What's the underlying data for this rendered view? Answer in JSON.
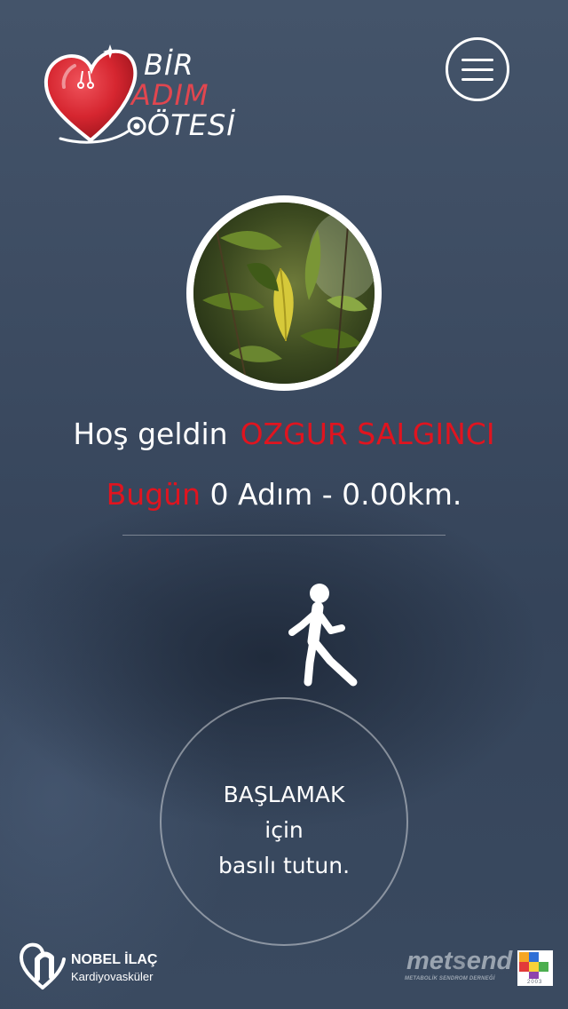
{
  "header": {
    "logo": {
      "word1": "BİR",
      "word2": "ADIM",
      "word3": "ÖTESİ",
      "icon": "heart-stethoscope-icon",
      "colors": {
        "heart": "#d62630",
        "word_accent": "#e1464f"
      }
    },
    "menu_icon": "hamburger-menu-icon"
  },
  "profile": {
    "avatar_icon": "leaf-photo",
    "welcome_prefix": "Hoş geldin",
    "user_name": "OZGUR SALGINCI"
  },
  "stats": {
    "today_label": "Bugün",
    "steps_text": " 0 Adım - 0.00km."
  },
  "walk_icon": "walking-person-icon",
  "start_button": {
    "line1": "BAŞLAMAK",
    "line2": "için",
    "line3": "basılı tutun."
  },
  "footer": {
    "nobel": {
      "name": "NOBEL İLAÇ",
      "sub": "Kardiyovasküler",
      "icon": "nobel-n-heart-icon"
    },
    "metsend": {
      "word_start": "met",
      "word_mid": "s",
      "word_end": "end",
      "tagline": "METABOLİK SENDROM DERNEĞİ",
      "year": "2003",
      "icon": "metsend-squares-icon"
    }
  },
  "colors": {
    "accent_red": "#e0141f",
    "text": "#ffffff",
    "background": "#3d4c62"
  }
}
